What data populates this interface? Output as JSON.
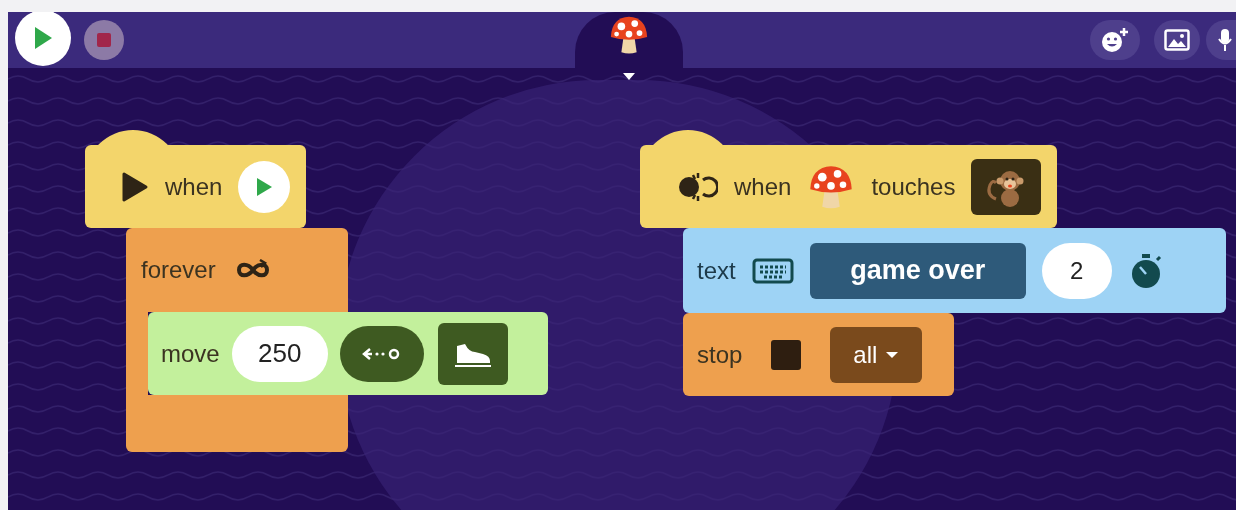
{
  "scripts": [
    {
      "blocks": [
        {
          "kind": "when_flag",
          "label": "when"
        },
        {
          "kind": "forever",
          "label": "forever",
          "children": [
            {
              "kind": "move",
              "label": "move",
              "value": "250"
            }
          ]
        }
      ]
    },
    {
      "blocks": [
        {
          "kind": "when_touches",
          "label": "when",
          "label_2": "touches"
        },
        {
          "kind": "show_text",
          "label": "text",
          "value": "game over",
          "seconds": "2"
        },
        {
          "kind": "stop",
          "label": "stop",
          "option": "all"
        }
      ]
    }
  ]
}
